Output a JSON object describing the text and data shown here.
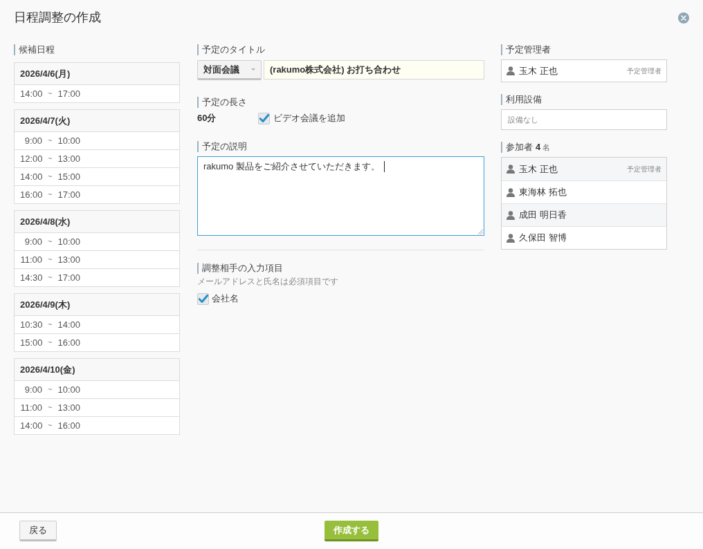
{
  "dialog": {
    "title": "日程調整の作成"
  },
  "candidates": {
    "label": "候補日程",
    "days": [
      {
        "date": "2026/4/6(月)",
        "slots": [
          {
            "start": "14:00",
            "separator": "~",
            "end": "17:00"
          }
        ]
      },
      {
        "date": "2026/4/7(火)",
        "slots": [
          {
            "start": "9:00",
            "separator": "~",
            "end": "10:00"
          },
          {
            "start": "12:00",
            "separator": "~",
            "end": "13:00"
          },
          {
            "start": "14:00",
            "separator": "~",
            "end": "15:00"
          },
          {
            "start": "16:00",
            "separator": "~",
            "end": "17:00"
          }
        ]
      },
      {
        "date": "2026/4/8(水)",
        "slots": [
          {
            "start": "9:00",
            "separator": "~",
            "end": "10:00"
          },
          {
            "start": "11:00",
            "separator": "~",
            "end": "13:00"
          },
          {
            "start": "14:30",
            "separator": "~",
            "end": "17:00"
          }
        ]
      },
      {
        "date": "2026/4/9(木)",
        "slots": [
          {
            "start": "10:30",
            "separator": "~",
            "end": "14:00"
          },
          {
            "start": "15:00",
            "separator": "~",
            "end": "16:00"
          }
        ]
      },
      {
        "date": "2026/4/10(金)",
        "slots": [
          {
            "start": "9:00",
            "separator": "~",
            "end": "10:00"
          },
          {
            "start": "11:00",
            "separator": "~",
            "end": "13:00"
          },
          {
            "start": "14:00",
            "separator": "~",
            "end": "16:00"
          }
        ]
      }
    ]
  },
  "event": {
    "title_label": "予定のタイトル",
    "type_select": "対面会議",
    "title_value": "(rakumo株式会社) お打ち合わせ",
    "duration_label": "予定の長さ",
    "duration": "60分",
    "video": {
      "label": "ビデオ会議を追加",
      "checked": true
    },
    "description_label": "予定の説明",
    "description": {
      "value": "rakumo 製品をご紹介させていただきます。",
      "focused": true
    }
  },
  "invitee_fields": {
    "label": "調整相手の入力項目",
    "note": "メールアドレスと氏名は必須項目です",
    "options": [
      {
        "label": "会社名",
        "checked": true
      }
    ]
  },
  "organizer": {
    "label": "予定管理者",
    "name": "玉木 正也",
    "role": "予定管理者"
  },
  "facilities": {
    "label": "利用設備",
    "placeholder": "設備なし"
  },
  "attendees": {
    "label": "参加者",
    "count": "4",
    "unit": "名",
    "people": [
      {
        "name": "玉木 正也",
        "role": "予定管理者"
      },
      {
        "name": "東海林 拓也"
      },
      {
        "name": "成田 明日香"
      },
      {
        "name": "久保田 智博"
      }
    ]
  },
  "footer": {
    "back": "戻る",
    "create": "作成する"
  }
}
